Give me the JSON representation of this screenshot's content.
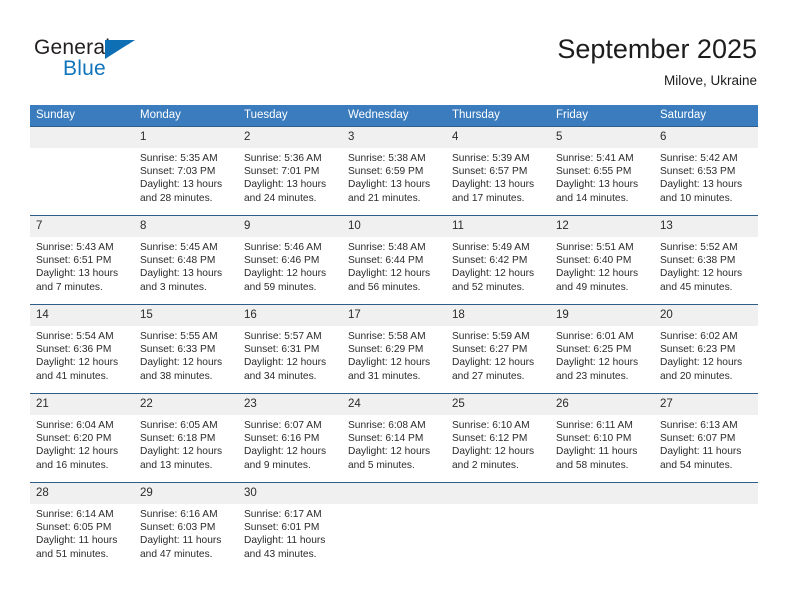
{
  "logo": {
    "word1": "General",
    "word2": "Blue",
    "triangle_color": "#0f6fb5",
    "word2_color": "#1175bc"
  },
  "header": {
    "title": "September 2025",
    "subtitle": "Milove, Ukraine",
    "header_bg": "#3a7cbe",
    "daynum_bg": "#f0f0f0",
    "row_border": "#2e5d87"
  },
  "weekdays": [
    "Sunday",
    "Monday",
    "Tuesday",
    "Wednesday",
    "Thursday",
    "Friday",
    "Saturday"
  ],
  "labels": {
    "sunrise_prefix": "Sunrise:",
    "sunset_prefix": "Sunset:",
    "daylight_prefix": "Daylight:"
  },
  "weeks": [
    [
      {
        "day": "",
        "blank": true
      },
      {
        "day": "1",
        "sunrise": "Sunrise: 5:35 AM",
        "sunset": "Sunset: 7:03 PM",
        "daylight1": "Daylight: 13 hours",
        "daylight2": "and 28 minutes."
      },
      {
        "day": "2",
        "sunrise": "Sunrise: 5:36 AM",
        "sunset": "Sunset: 7:01 PM",
        "daylight1": "Daylight: 13 hours",
        "daylight2": "and 24 minutes."
      },
      {
        "day": "3",
        "sunrise": "Sunrise: 5:38 AM",
        "sunset": "Sunset: 6:59 PM",
        "daylight1": "Daylight: 13 hours",
        "daylight2": "and 21 minutes."
      },
      {
        "day": "4",
        "sunrise": "Sunrise: 5:39 AM",
        "sunset": "Sunset: 6:57 PM",
        "daylight1": "Daylight: 13 hours",
        "daylight2": "and 17 minutes."
      },
      {
        "day": "5",
        "sunrise": "Sunrise: 5:41 AM",
        "sunset": "Sunset: 6:55 PM",
        "daylight1": "Daylight: 13 hours",
        "daylight2": "and 14 minutes."
      },
      {
        "day": "6",
        "sunrise": "Sunrise: 5:42 AM",
        "sunset": "Sunset: 6:53 PM",
        "daylight1": "Daylight: 13 hours",
        "daylight2": "and 10 minutes."
      }
    ],
    [
      {
        "day": "7",
        "sunrise": "Sunrise: 5:43 AM",
        "sunset": "Sunset: 6:51 PM",
        "daylight1": "Daylight: 13 hours",
        "daylight2": "and 7 minutes."
      },
      {
        "day": "8",
        "sunrise": "Sunrise: 5:45 AM",
        "sunset": "Sunset: 6:48 PM",
        "daylight1": "Daylight: 13 hours",
        "daylight2": "and 3 minutes."
      },
      {
        "day": "9",
        "sunrise": "Sunrise: 5:46 AM",
        "sunset": "Sunset: 6:46 PM",
        "daylight1": "Daylight: 12 hours",
        "daylight2": "and 59 minutes."
      },
      {
        "day": "10",
        "sunrise": "Sunrise: 5:48 AM",
        "sunset": "Sunset: 6:44 PM",
        "daylight1": "Daylight: 12 hours",
        "daylight2": "and 56 minutes."
      },
      {
        "day": "11",
        "sunrise": "Sunrise: 5:49 AM",
        "sunset": "Sunset: 6:42 PM",
        "daylight1": "Daylight: 12 hours",
        "daylight2": "and 52 minutes."
      },
      {
        "day": "12",
        "sunrise": "Sunrise: 5:51 AM",
        "sunset": "Sunset: 6:40 PM",
        "daylight1": "Daylight: 12 hours",
        "daylight2": "and 49 minutes."
      },
      {
        "day": "13",
        "sunrise": "Sunrise: 5:52 AM",
        "sunset": "Sunset: 6:38 PM",
        "daylight1": "Daylight: 12 hours",
        "daylight2": "and 45 minutes."
      }
    ],
    [
      {
        "day": "14",
        "sunrise": "Sunrise: 5:54 AM",
        "sunset": "Sunset: 6:36 PM",
        "daylight1": "Daylight: 12 hours",
        "daylight2": "and 41 minutes."
      },
      {
        "day": "15",
        "sunrise": "Sunrise: 5:55 AM",
        "sunset": "Sunset: 6:33 PM",
        "daylight1": "Daylight: 12 hours",
        "daylight2": "and 38 minutes."
      },
      {
        "day": "16",
        "sunrise": "Sunrise: 5:57 AM",
        "sunset": "Sunset: 6:31 PM",
        "daylight1": "Daylight: 12 hours",
        "daylight2": "and 34 minutes."
      },
      {
        "day": "17",
        "sunrise": "Sunrise: 5:58 AM",
        "sunset": "Sunset: 6:29 PM",
        "daylight1": "Daylight: 12 hours",
        "daylight2": "and 31 minutes."
      },
      {
        "day": "18",
        "sunrise": "Sunrise: 5:59 AM",
        "sunset": "Sunset: 6:27 PM",
        "daylight1": "Daylight: 12 hours",
        "daylight2": "and 27 minutes."
      },
      {
        "day": "19",
        "sunrise": "Sunrise: 6:01 AM",
        "sunset": "Sunset: 6:25 PM",
        "daylight1": "Daylight: 12 hours",
        "daylight2": "and 23 minutes."
      },
      {
        "day": "20",
        "sunrise": "Sunrise: 6:02 AM",
        "sunset": "Sunset: 6:23 PM",
        "daylight1": "Daylight: 12 hours",
        "daylight2": "and 20 minutes."
      }
    ],
    [
      {
        "day": "21",
        "sunrise": "Sunrise: 6:04 AM",
        "sunset": "Sunset: 6:20 PM",
        "daylight1": "Daylight: 12 hours",
        "daylight2": "and 16 minutes."
      },
      {
        "day": "22",
        "sunrise": "Sunrise: 6:05 AM",
        "sunset": "Sunset: 6:18 PM",
        "daylight1": "Daylight: 12 hours",
        "daylight2": "and 13 minutes."
      },
      {
        "day": "23",
        "sunrise": "Sunrise: 6:07 AM",
        "sunset": "Sunset: 6:16 PM",
        "daylight1": "Daylight: 12 hours",
        "daylight2": "and 9 minutes."
      },
      {
        "day": "24",
        "sunrise": "Sunrise: 6:08 AM",
        "sunset": "Sunset: 6:14 PM",
        "daylight1": "Daylight: 12 hours",
        "daylight2": "and 5 minutes."
      },
      {
        "day": "25",
        "sunrise": "Sunrise: 6:10 AM",
        "sunset": "Sunset: 6:12 PM",
        "daylight1": "Daylight: 12 hours",
        "daylight2": "and 2 minutes."
      },
      {
        "day": "26",
        "sunrise": "Sunrise: 6:11 AM",
        "sunset": "Sunset: 6:10 PM",
        "daylight1": "Daylight: 11 hours",
        "daylight2": "and 58 minutes."
      },
      {
        "day": "27",
        "sunrise": "Sunrise: 6:13 AM",
        "sunset": "Sunset: 6:07 PM",
        "daylight1": "Daylight: 11 hours",
        "daylight2": "and 54 minutes."
      }
    ],
    [
      {
        "day": "28",
        "sunrise": "Sunrise: 6:14 AM",
        "sunset": "Sunset: 6:05 PM",
        "daylight1": "Daylight: 11 hours",
        "daylight2": "and 51 minutes."
      },
      {
        "day": "29",
        "sunrise": "Sunrise: 6:16 AM",
        "sunset": "Sunset: 6:03 PM",
        "daylight1": "Daylight: 11 hours",
        "daylight2": "and 47 minutes."
      },
      {
        "day": "30",
        "sunrise": "Sunrise: 6:17 AM",
        "sunset": "Sunset: 6:01 PM",
        "daylight1": "Daylight: 11 hours",
        "daylight2": "and 43 minutes."
      },
      {
        "day": "",
        "blank": true
      },
      {
        "day": "",
        "blank": true
      },
      {
        "day": "",
        "blank": true
      },
      {
        "day": "",
        "blank": true
      }
    ]
  ]
}
